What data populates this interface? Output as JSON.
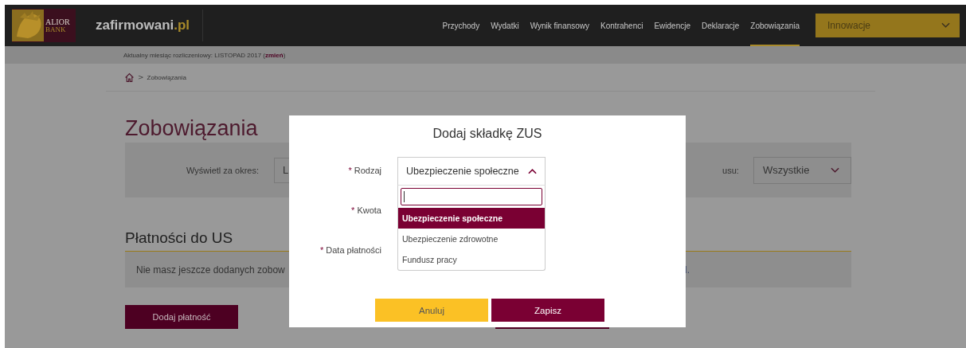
{
  "header": {
    "logo": {
      "line1": "ALIOR",
      "line2": "BANK"
    },
    "site_name": "zafirmowani",
    "site_tld": ".pl",
    "nav": [
      {
        "label": "Przychody",
        "selected": false
      },
      {
        "label": "Wydatki",
        "selected": false
      },
      {
        "label": "Wynik finansowy",
        "selected": false
      },
      {
        "label": "Kontrahenci",
        "selected": false
      },
      {
        "label": "Ewidencje",
        "selected": false
      },
      {
        "label": "Deklaracje",
        "selected": false
      },
      {
        "label": "Zobowiązania",
        "selected": true
      }
    ],
    "menu": {
      "label": "Innowacje"
    }
  },
  "period_bar": {
    "text": "Aktualny miesiąc rozliczeniowy: LISTOPAD 2017 (",
    "link": "zmień",
    "text_end": ")"
  },
  "breadcrumb": {
    "separator": ">",
    "current": "Zobowiązania"
  },
  "page_title": "Zobowiązania",
  "filters": {
    "period_label": "Wyświetl za okres:",
    "period_value": "L",
    "status_label": "usu:",
    "status_value": "Wszystkie"
  },
  "section_title": "Płatności do US",
  "notice": {
    "start": "Nie masz jeszcze dodanych zobow",
    "end": "l."
  },
  "add_button": "Dodaj płatność",
  "modal": {
    "title": "Dodaj składkę ZUS",
    "fields": [
      {
        "label": "Rodzaj",
        "required": "*"
      },
      {
        "label": "Kwota",
        "required": "*"
      },
      {
        "label": "Data płatności",
        "required": "*"
      }
    ],
    "select": {
      "value": "Ubezpieczenie społeczne",
      "expanded": true,
      "options": [
        {
          "label": "Ubezpieczenie społeczne",
          "selected": true
        },
        {
          "label": "Ubezpieczenie zdrowotne",
          "selected": false
        },
        {
          "label": "Fundusz pracy",
          "selected": false
        }
      ]
    },
    "buttons": [
      {
        "label": "Anuluj",
        "kind": "cancel"
      },
      {
        "label": "Zapisz",
        "kind": "save"
      }
    ]
  }
}
